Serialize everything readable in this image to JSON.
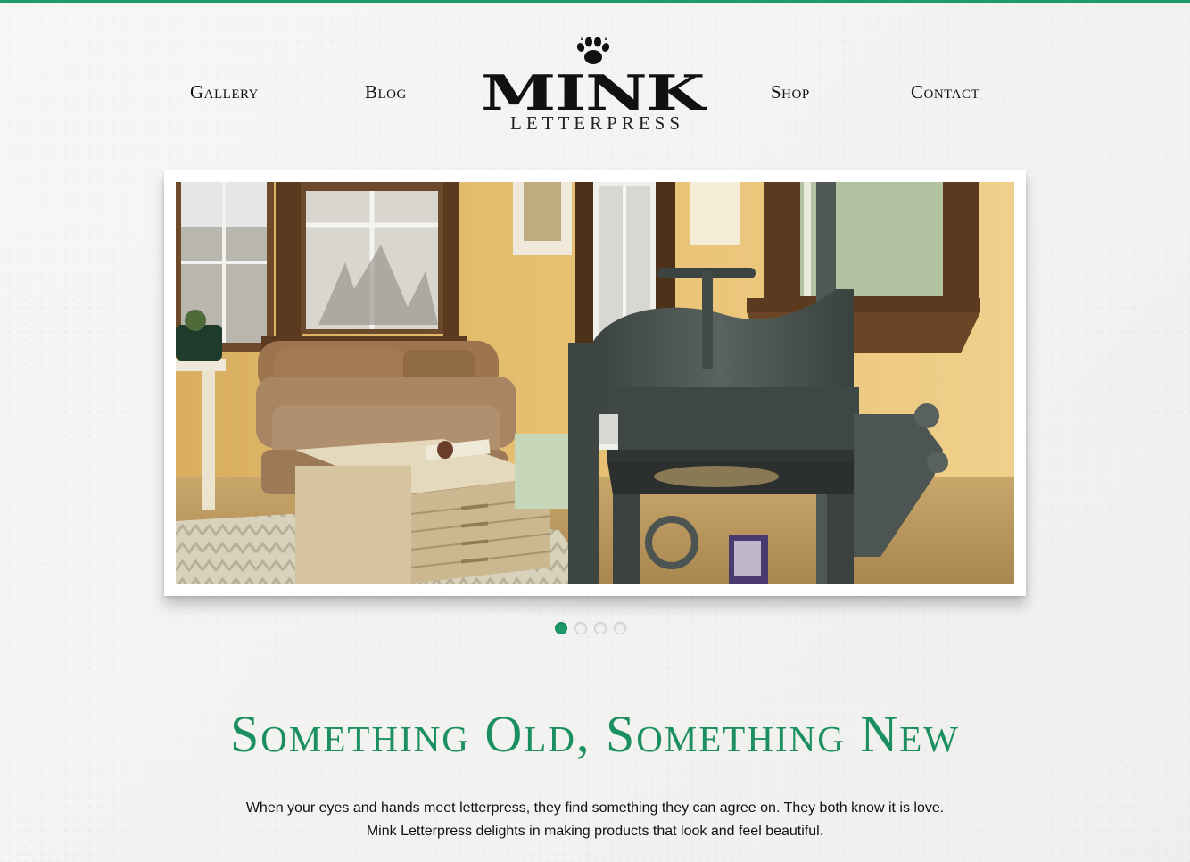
{
  "brand": {
    "name": "MINK",
    "subtitle": "LETTERPRESS",
    "accent_color": "#1d9a6c"
  },
  "nav": {
    "gallery": "Gallery",
    "blog": "Blog",
    "shop": "Shop",
    "contact": "Contact"
  },
  "slideshow": {
    "slide_count": 4,
    "active_slide": 1,
    "image_description": "Letterpress studio room with vintage paper cutter, flat file cabinet coffee table, brown loveseat and windows"
  },
  "headline": "Something Old, Something New",
  "intro": {
    "line1": "When your eyes and hands meet letterpress, they find something they can agree on. They both know it is love.",
    "line2": "Mink Letterpress delights in making products that look and feel beautiful."
  }
}
